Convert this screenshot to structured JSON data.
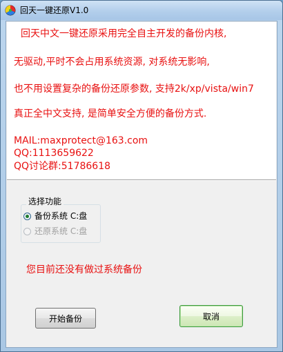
{
  "window": {
    "title": "回天一键还原V1.0"
  },
  "info": {
    "lines": [
      "回天中文一键还原采用完全自主开发的备份内核,",
      "无驱动,平时不会占用系统资源, 对系统无影响,",
      "也不用设置复杂的备份还原参数, 支持2k/xp/vista/win7",
      "真正全中文支持, 是简单安全方便的备份方式."
    ],
    "contact": [
      "MAIL:maxprotect@163.com",
      "QQ:1113659622",
      "QQ讨论群:51786618"
    ]
  },
  "group": {
    "legend": "选择功能",
    "options": [
      {
        "label": "备份系统 C:盘",
        "checked": true,
        "enabled": true
      },
      {
        "label": "还原系统 C:盘",
        "checked": false,
        "enabled": false
      }
    ]
  },
  "status": "您目前还没有做过系统备份",
  "buttons": {
    "start": "开始备份",
    "cancel": "取消"
  },
  "colors": {
    "text_red": "#e81010",
    "panel_bg": "#ffffff",
    "dialog_bg": "#f0f0f0"
  }
}
